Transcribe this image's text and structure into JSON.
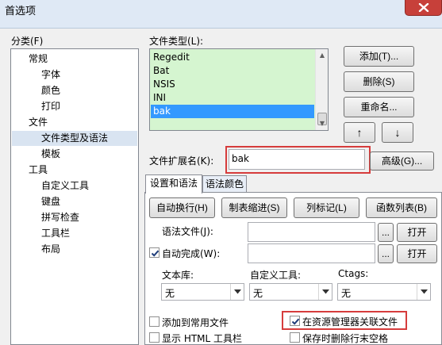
{
  "window": {
    "title": "首选项"
  },
  "category": {
    "label": "分类(F)",
    "items": [
      {
        "label": "常规"
      },
      {
        "label": "字体"
      },
      {
        "label": "颜色"
      },
      {
        "label": "打印"
      },
      {
        "label": "文件"
      },
      {
        "label": "文件类型及语法"
      },
      {
        "label": "模板"
      },
      {
        "label": "工具"
      },
      {
        "label": "自定义工具"
      },
      {
        "label": "键盘"
      },
      {
        "label": "拼写检查"
      },
      {
        "label": "工具栏"
      },
      {
        "label": "布局"
      }
    ]
  },
  "file_types": {
    "label": "文件类型(L):",
    "items": [
      "Regedit",
      "Bat",
      "NSIS",
      "INI",
      "bak"
    ],
    "selected": "bak"
  },
  "buttons": {
    "add": "添加(T)...",
    "delete": "删除(S)",
    "rename": "重命名...",
    "up": "↑",
    "down": "↓",
    "advanced": "高级(G)..."
  },
  "extension": {
    "label": "文件扩展名(K):",
    "value": "bak"
  },
  "tabs": [
    {
      "label": "设置和语法"
    },
    {
      "label": "语法颜色"
    }
  ],
  "settings": {
    "auto_wrap": "自动换行(H)",
    "tab_indent": "制表缩进(S)",
    "column_marker": "列标记(L)",
    "function_list": "函数列表(B)",
    "syntax_file_label": "语法文件(J):",
    "syntax_file_value": "",
    "auto_complete_label": "自动完成(W):",
    "auto_complete_checked": true,
    "auto_complete_value": "",
    "browse": "...",
    "open": "打开",
    "library_label": "文本库:",
    "library_value": "无",
    "custom_tool_label": "自定义工具:",
    "custom_tool_value": "无",
    "ctags_label": "Ctags:",
    "ctags_value": "无",
    "add_to_recent": "添加到常用文件",
    "add_to_recent_checked": false,
    "explorer_assoc": "在资源管理器关联文件",
    "explorer_assoc_checked": true,
    "show_html_toolbar": "显示 HTML 工具栏",
    "show_html_toolbar_checked": false,
    "trim_trailing": "保存时删除行末空格",
    "trim_trailing_checked": false
  },
  "colors": {
    "list_bg": "#d5f5d0",
    "selection": "#3399ff",
    "highlight": "#d63c3c",
    "close": "#c7403a"
  }
}
